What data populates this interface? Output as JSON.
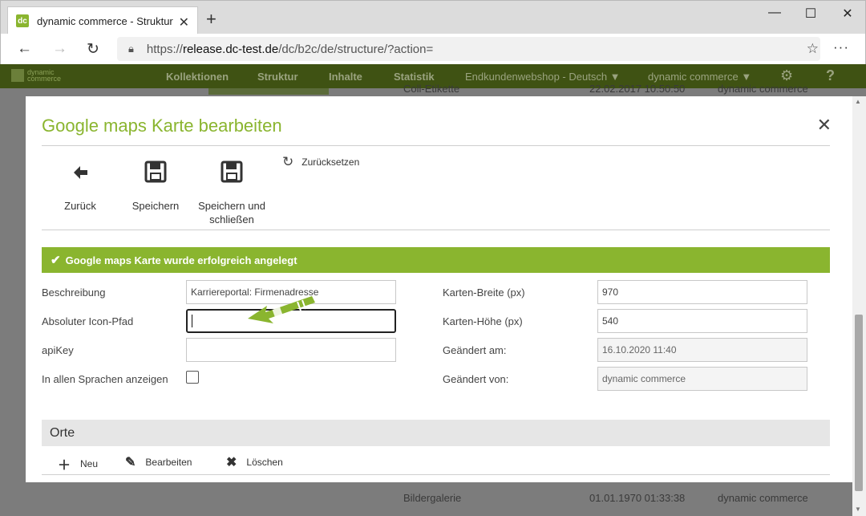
{
  "browser": {
    "tab_title": "dynamic commerce - Struktur",
    "tab_close": "✕",
    "new_tab": "+",
    "url_prefix": "https://",
    "url_host": "release.dc-test.de",
    "url_path": "/dc/b2c/de/structure/?action=",
    "min": "—",
    "max": "☐",
    "close": "✕",
    "back": "←",
    "forward": "→",
    "reload": "↻",
    "star": "☆",
    "more": "···"
  },
  "app": {
    "logo_text_1": "dynamic",
    "logo_text_2": "commerce",
    "nav": [
      "Kollektionen",
      "Struktur",
      "Inhalte",
      "Statistik"
    ],
    "shop_select": "Endkundenwebshop - Deutsch",
    "company_select": "dynamic commerce",
    "help": "?"
  },
  "background": {
    "row_top_name": "Coll-Etikette",
    "row_top_date": "22.02.2017 10:50:50",
    "row_top_user": "dynamic commerce",
    "row_bottom_name": "Bildergalerie",
    "row_bottom_date": "01.01.1970 01:33:38",
    "row_bottom_user": "dynamic commerce"
  },
  "modal": {
    "title": "Google maps Karte bearbeiten",
    "close": "✕",
    "toolbar": {
      "back": "Zurück",
      "save": "Speichern",
      "save_close_1": "Speichern und",
      "save_close_2": "schließen",
      "reset": "Zurücksetzen"
    },
    "alert": "Google maps Karte wurde erfolgreich angelegt",
    "form": {
      "beschreibung_label": "Beschreibung",
      "beschreibung_value": "Karriereportal: Firmenadresse",
      "icon_pfad_label": "Absoluter Icon-Pfad",
      "icon_pfad_value": "",
      "apikey_label": "apiKey",
      "apikey_value": "",
      "sprachen_label": "In allen Sprachen anzeigen",
      "breite_label": "Karten-Breite (px)",
      "breite_value": "970",
      "hoehe_label": "Karten-Höhe (px)",
      "hoehe_value": "540",
      "geaendert_am_label": "Geändert am:",
      "geaendert_am_value": "16.10.2020 11:40",
      "geaendert_von_label": "Geändert von:",
      "geaendert_von_value": "dynamic commerce"
    },
    "section_title": "Orte",
    "actions": {
      "new": "Neu",
      "edit": "Bearbeiten",
      "delete": "Löschen"
    }
  },
  "colors": {
    "brand_green": "#8ab52f",
    "app_header_dimmed": "#3f5213"
  }
}
